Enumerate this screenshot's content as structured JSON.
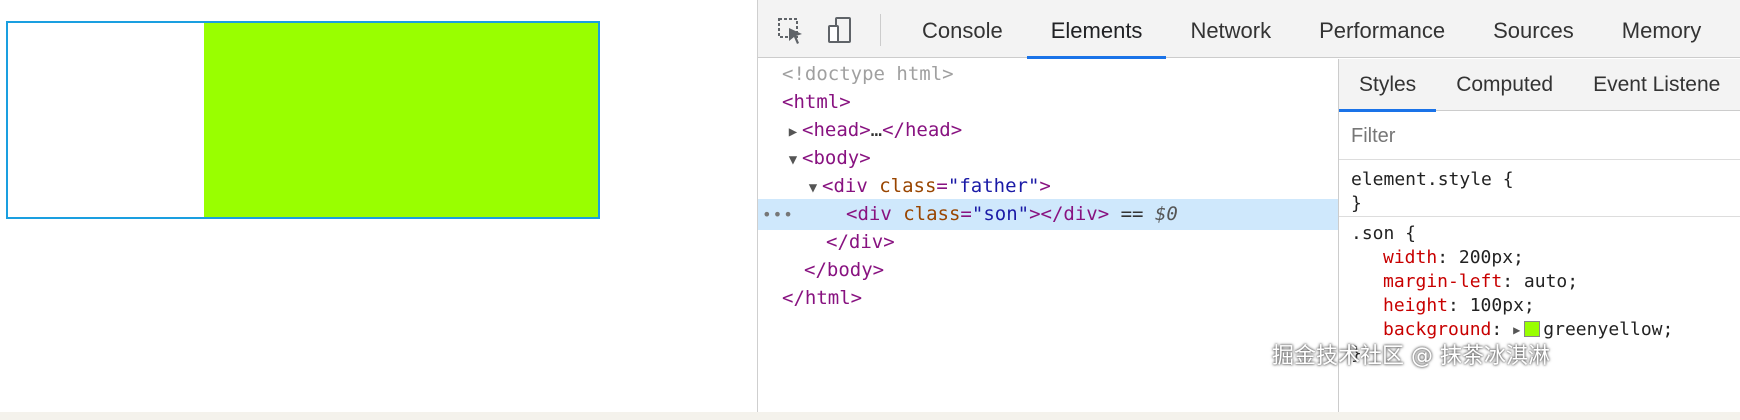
{
  "preview": {
    "father_border_color": "#1a9fe0",
    "son_background": "#99ff00"
  },
  "toolbar": {
    "inspect_icon": "inspect-element-icon",
    "device_icon": "device-toolbar-icon",
    "tabs": [
      {
        "label": "Console"
      },
      {
        "label": "Elements",
        "active": true
      },
      {
        "label": "Network"
      },
      {
        "label": "Performance"
      },
      {
        "label": "Sources"
      },
      {
        "label": "Memory"
      }
    ]
  },
  "dom": {
    "doctype": "<!doctype html>",
    "html_open": "<html>",
    "head_open": "<head>",
    "head_ellipsis": "…",
    "head_close": "</head>",
    "body_open": "<body>",
    "div_father_open_tag": "<div",
    "div_father_attr_name": "class",
    "div_father_attr_val": "\"father\"",
    "div_father_close_bracket": ">",
    "row_dots": "•••",
    "div_son_open_tag": "<div",
    "div_son_attr_name": "class",
    "div_son_attr_val": "\"son\"",
    "div_son_close": "></div>",
    "selected_eq": "==",
    "selected_ref": "$0",
    "div_close": "</div>",
    "body_close": "</body>",
    "html_close": "</html>"
  },
  "styles": {
    "sub_tabs": [
      {
        "label": "Styles",
        "active": true
      },
      {
        "label": "Computed"
      },
      {
        "label": "Event Listene"
      }
    ],
    "filter_placeholder": "Filter",
    "element_style_selector": "element.style {",
    "element_style_close": "}",
    "son_selector": ".son {",
    "son_props": [
      {
        "name": "width",
        "value": "200px;"
      },
      {
        "name": "margin-left",
        "value": "auto;"
      },
      {
        "name": "height",
        "value": "100px;"
      },
      {
        "name": "background",
        "value": "greenyellow;"
      }
    ],
    "son_close": "}",
    "swatch_color": "#99ff00"
  },
  "watermark": "掘金技术社区 @ 抹茶冰淇淋"
}
